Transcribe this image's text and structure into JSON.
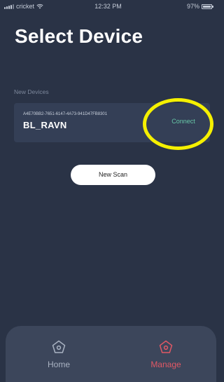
{
  "status_bar": {
    "carrier": "cricket",
    "time": "12:32 PM",
    "battery": "97%"
  },
  "title": "Select Device",
  "section_label": "New Devices",
  "device": {
    "uuid": "A4E70BB2-7651-6147-4A73-941D47FB8301",
    "name": "BL_RAVN",
    "connect_label": "Connect"
  },
  "new_scan_label": "New Scan",
  "nav": {
    "home_label": "Home",
    "manage_label": "Manage",
    "active": "manage"
  },
  "colors": {
    "background": "#2a3346",
    "card": "#343f56",
    "connect_text": "#67c7a7",
    "highlight": "#f5f000",
    "active_tab": "#e05865",
    "inactive_tab": "#aab3c3"
  },
  "icons": {
    "home": "home-pentagon-icon",
    "manage": "manage-pentagon-icon"
  }
}
